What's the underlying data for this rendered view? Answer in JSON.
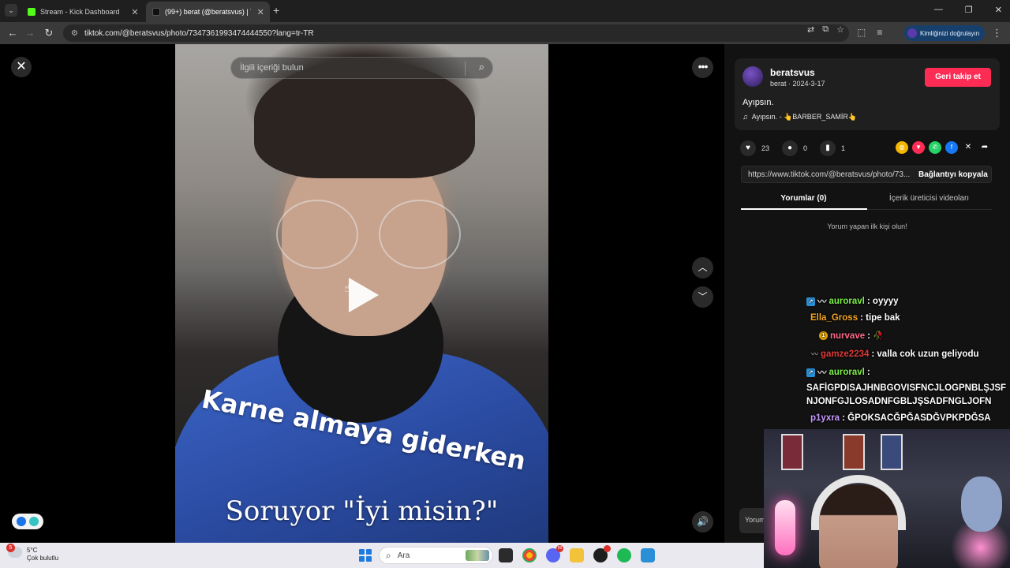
{
  "browser": {
    "tabs": [
      {
        "title": "Stream - Kick Dashboard",
        "favicon_color": "#53fc18"
      },
      {
        "title": "(99+) berat (@beratsvus) | T",
        "favicon_color": "#111111"
      }
    ],
    "url": "tiktok.com/@beratsvus/photo/7347361993474444550?lang=tr-TR",
    "verify_label": "Kimliğinizi doğrulayın"
  },
  "viewer": {
    "search_placeholder": "İlgili içeriği bulun",
    "caption_top": "Karne almaya giderken",
    "caption_bottom": "Soruyor \"İyi misin?\""
  },
  "post": {
    "username": "beratsvus",
    "meta": "berat · 2024-3-17",
    "follow_label": "Geri takip et",
    "description": "Ayıpsın.",
    "music": "Ayıpsın. - 👆BARBER_SAMİR👆",
    "likes": "23",
    "comments": "0",
    "saves": "1",
    "link": "https://www.tiktok.com/@beratsvus/photo/73...",
    "copy_link_label": "Bağlantıyı kopyala",
    "tab_comments": "Yorumlar (0)",
    "tab_creator_videos": "İçerik üreticisi videoları",
    "empty_comments": "Yorum yapan ilk kişi olun!",
    "comment_placeholder": "Yorum"
  },
  "chat": {
    "messages": [
      {
        "user": "auroravl",
        "text": ": oyyyy",
        "color": "#7ff04a"
      },
      {
        "user": "Ella_Gross",
        "text": ": tipe bak",
        "color": "#f5a623"
      },
      {
        "user": "nurvave",
        "text": ":",
        "color": "#ff6b8a"
      },
      {
        "user": "gamze2234",
        "text": ": valla cok uzun geliyodu",
        "color": "#e03a3a"
      },
      {
        "user": "auroravl",
        "text": ":",
        "color": "#7ff04a"
      },
      {
        "user": "p1yxra",
        "text": ": ĞPOKSACĞPĞASDĞVPKPDĞSA",
        "color": "#c89cff"
      }
    ],
    "long_text": "SAFİGPDISAJHNBGOVISFNCJLOGPNBLŞJSFNJONFGJLOSADNFGBLJŞSADFNGLJOFN"
  },
  "taskbar": {
    "weather_temp": "5°C",
    "weather_desc": "Çok bulutlu",
    "weather_badge": "5",
    "search_label": "Ara"
  },
  "colors": {
    "follow": "#fe2c55",
    "panel_bg": "#121212"
  }
}
